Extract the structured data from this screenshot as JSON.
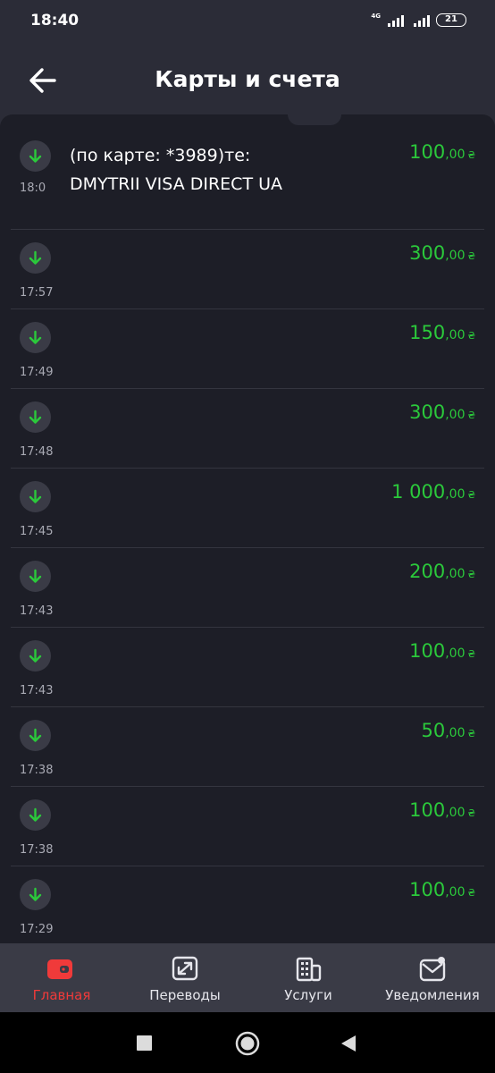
{
  "status_bar": {
    "time": "18:40",
    "network": "4G",
    "battery": "21"
  },
  "header": {
    "title": "Карты и счета"
  },
  "transactions": [
    {
      "time": "18:0",
      "amount_int": "100",
      "amount_dec": ",00",
      "currency": "₴",
      "description_line1": "(по карте: *3989)те:",
      "description_line2": "DMYTRII VISA DIRECT UA"
    },
    {
      "time": "17:57",
      "amount_int": "300",
      "amount_dec": ",00",
      "currency": "₴"
    },
    {
      "time": "17:49",
      "amount_int": "150",
      "amount_dec": ",00",
      "currency": "₴"
    },
    {
      "time": "17:48",
      "amount_int": "300",
      "amount_dec": ",00",
      "currency": "₴"
    },
    {
      "time": "17:45",
      "amount_int": "1 000",
      "amount_dec": ",00",
      "currency": "₴"
    },
    {
      "time": "17:43",
      "amount_int": "200",
      "amount_dec": ",00",
      "currency": "₴"
    },
    {
      "time": "17:43",
      "amount_int": "100",
      "amount_dec": ",00",
      "currency": "₴"
    },
    {
      "time": "17:38",
      "amount_int": "50",
      "amount_dec": ",00",
      "currency": "₴"
    },
    {
      "time": "17:38",
      "amount_int": "100",
      "amount_dec": ",00",
      "currency": "₴"
    },
    {
      "time": "17:29",
      "amount_int": "100",
      "amount_dec": ",00",
      "currency": "₴"
    }
  ],
  "bottom_nav": {
    "items": [
      {
        "label": "Главная",
        "icon": "wallet-icon",
        "active": true
      },
      {
        "label": "Переводы",
        "icon": "transfers-icon",
        "active": false
      },
      {
        "label": "Услуги",
        "icon": "services-building-icon",
        "active": false
      },
      {
        "label": "Уведомления",
        "icon": "notifications-mail-icon",
        "active": false
      }
    ]
  },
  "colors": {
    "accent": "#f03a3a",
    "income_green": "#2bc93b",
    "background": "#1d1e27",
    "header_background": "#2b2c37"
  }
}
